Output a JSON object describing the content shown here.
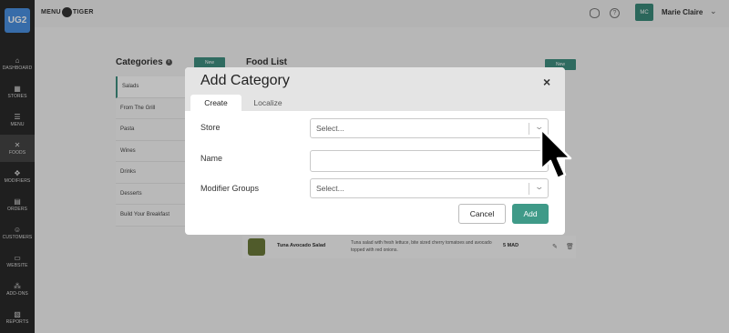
{
  "sidebar": {
    "brand": "UG2",
    "items": [
      {
        "label": "DASHBOARD",
        "icon": "home-icon",
        "glyph": "⌂"
      },
      {
        "label": "STORES",
        "icon": "store-icon",
        "glyph": "▦"
      },
      {
        "label": "MENU",
        "icon": "menu-icon",
        "glyph": "☰"
      },
      {
        "label": "FOODS",
        "icon": "foods-icon",
        "glyph": "✕"
      },
      {
        "label": "MODIFIERS",
        "icon": "modifiers-icon",
        "glyph": "✥"
      },
      {
        "label": "ORDERS",
        "icon": "orders-icon",
        "glyph": "▤"
      },
      {
        "label": "CUSTOMERS",
        "icon": "customers-icon",
        "glyph": "☺"
      },
      {
        "label": "WEBSITE",
        "icon": "website-icon",
        "glyph": "▭"
      },
      {
        "label": "ADD-ONS",
        "icon": "addons-icon",
        "glyph": "⁂"
      },
      {
        "label": "REPORTS",
        "icon": "reports-icon",
        "glyph": "▧"
      }
    ]
  },
  "topbar": {
    "logo_left": "MENU",
    "logo_right": "TIGER",
    "help_glyph": "?",
    "avatar_initials": "MC",
    "username": "Marie Claire",
    "caret": "⌄"
  },
  "categories": {
    "title": "Categories",
    "info_glyph": "i",
    "new_label": "New",
    "items": [
      "Salads",
      "From The Grill",
      "Pasta",
      "Wines",
      "Drinks",
      "Desserts",
      "Build Your Breakfast"
    ]
  },
  "food_list": {
    "title": "Food List",
    "new_label": "New",
    "row": {
      "name": "Tuna Avocado Salad",
      "description": "Tuna salad with fresh lettuce, bite sized cherry tomatoes and avocado topped with red onions.",
      "price": "5 MAD",
      "edit_glyph": "✎",
      "delete_glyph": "🗑"
    }
  },
  "modal": {
    "title": "Add Category",
    "close_glyph": "×",
    "tabs": [
      "Create",
      "Localize"
    ],
    "fields": {
      "store_label": "Store",
      "store_placeholder": "Select...",
      "name_label": "Name",
      "modifier_label": "Modifier Groups",
      "modifier_placeholder": "Select...",
      "caret": "⌄"
    },
    "cancel_label": "Cancel",
    "add_label": "Add"
  },
  "colors": {
    "accent": "#3f9a88",
    "sidebar": "#2a2a2a",
    "brand": "#4a90e2"
  }
}
